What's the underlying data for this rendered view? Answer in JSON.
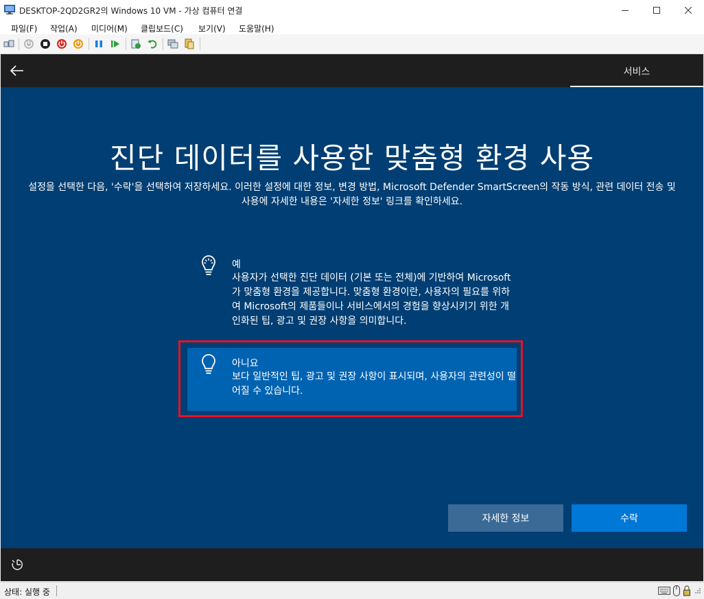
{
  "window": {
    "title": "DESKTOP-2QD2GR2의 Windows 10 VM - 가상 컴퓨터 연결",
    "controls": [
      "minimize-icon",
      "maximize-icon",
      "close-icon"
    ]
  },
  "menu": {
    "items": [
      {
        "label": "파일(F)"
      },
      {
        "label": "작업(A)"
      },
      {
        "label": "미디어(M)"
      },
      {
        "label": "클립보드(C)"
      },
      {
        "label": "보기(V)"
      },
      {
        "label": "도움말(H)"
      }
    ]
  },
  "toolbar": {
    "icons": [
      "ctrl-alt-del-icon",
      "start-icon",
      "turn-off-icon",
      "shut-down-icon",
      "power-icon",
      "pause-icon",
      "resume-icon",
      "checkpoint-icon",
      "revert-icon",
      "enhanced-session-icon",
      "share-icon"
    ]
  },
  "oobe": {
    "tab_label": "서비스",
    "heading": "진단 데이터를 사용한 맞춤형 환경 사용",
    "subtitle": "설정을 선택한 다음, '수락'을 선택하여 저장하세요. 이러한 설정에 대한 정보, 변경 방법, Microsoft Defender SmartScreen의 작동 방식, 관련 데이터 전송 및 사용에 자세한 내용은 '자세한 정보' 링크를 확인하세요.",
    "options": [
      {
        "title": "예",
        "description": "사용자가 선택한 진단 데이터 (기본 또는 전체)에 기반하여 Microsoft가 맞춤형 환경을 제공합니다. 맞춤형 환경이란, 사용자의 필요를 위하여 Microsoft의 제품들이나 서비스에서의 경험을 향상시키기 위한 개인화된 팁, 광고 및 권장 사항을 의미합니다.",
        "selected": false
      },
      {
        "title": "아니요",
        "description": "보다 일반적인 팁, 광고 및 권장 사항이 표시되며, 사용자의 관련성이 떨어질 수 있습니다.",
        "selected": true
      }
    ],
    "buttons": {
      "learn_more": "자세한 정보",
      "accept": "수락"
    },
    "colors": {
      "background": "#003e73",
      "selected_option": "#0063b1",
      "accept_button": "#0078d7",
      "highlight_box": "#e81123"
    }
  },
  "status": {
    "text": "상태: 실행 중"
  }
}
